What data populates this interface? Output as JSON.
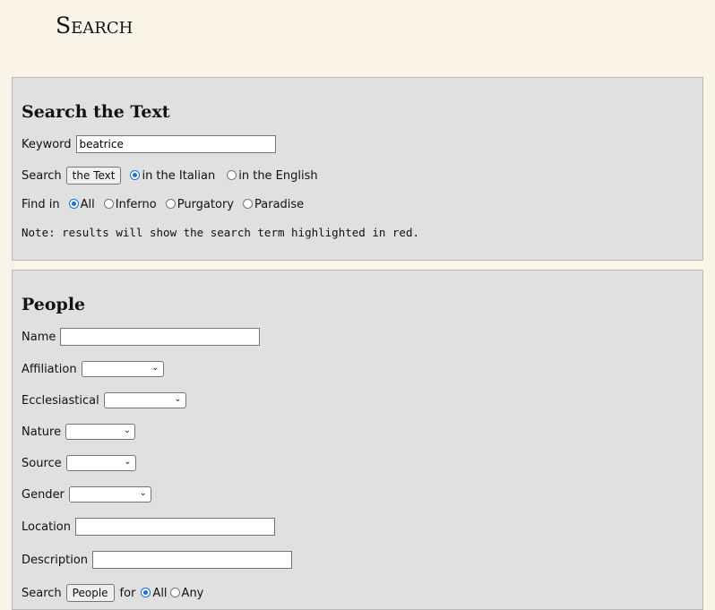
{
  "page": {
    "title": "Search"
  },
  "text_search": {
    "heading": "Search the Text",
    "keyword_label": "Keyword",
    "keyword_value": "beatrice",
    "search_label": "Search",
    "search_button": "the Text",
    "language_options": [
      {
        "label": "in the Italian",
        "checked": true
      },
      {
        "label": "in the English",
        "checked": false
      }
    ],
    "find_label": "Find in",
    "find_options": [
      {
        "label": "All",
        "checked": true
      },
      {
        "label": "Inferno",
        "checked": false
      },
      {
        "label": "Purgatory",
        "checked": false
      },
      {
        "label": "Paradise",
        "checked": false
      }
    ],
    "note": "Note: results will show the search term highlighted in red."
  },
  "people": {
    "heading": "People",
    "name_label": "Name",
    "name_value": "",
    "affiliation_label": "Affiliation",
    "ecclesiastical_label": "Ecclesiastical",
    "nature_label": "Nature",
    "source_label": "Source",
    "gender_label": "Gender",
    "location_label": "Location",
    "location_value": "",
    "description_label": "Description",
    "description_value": "",
    "search_label": "Search",
    "search_button": "People",
    "for_label": "for",
    "for_options": [
      {
        "label": "All",
        "checked": true
      },
      {
        "label": "Any",
        "checked": false
      }
    ]
  }
}
